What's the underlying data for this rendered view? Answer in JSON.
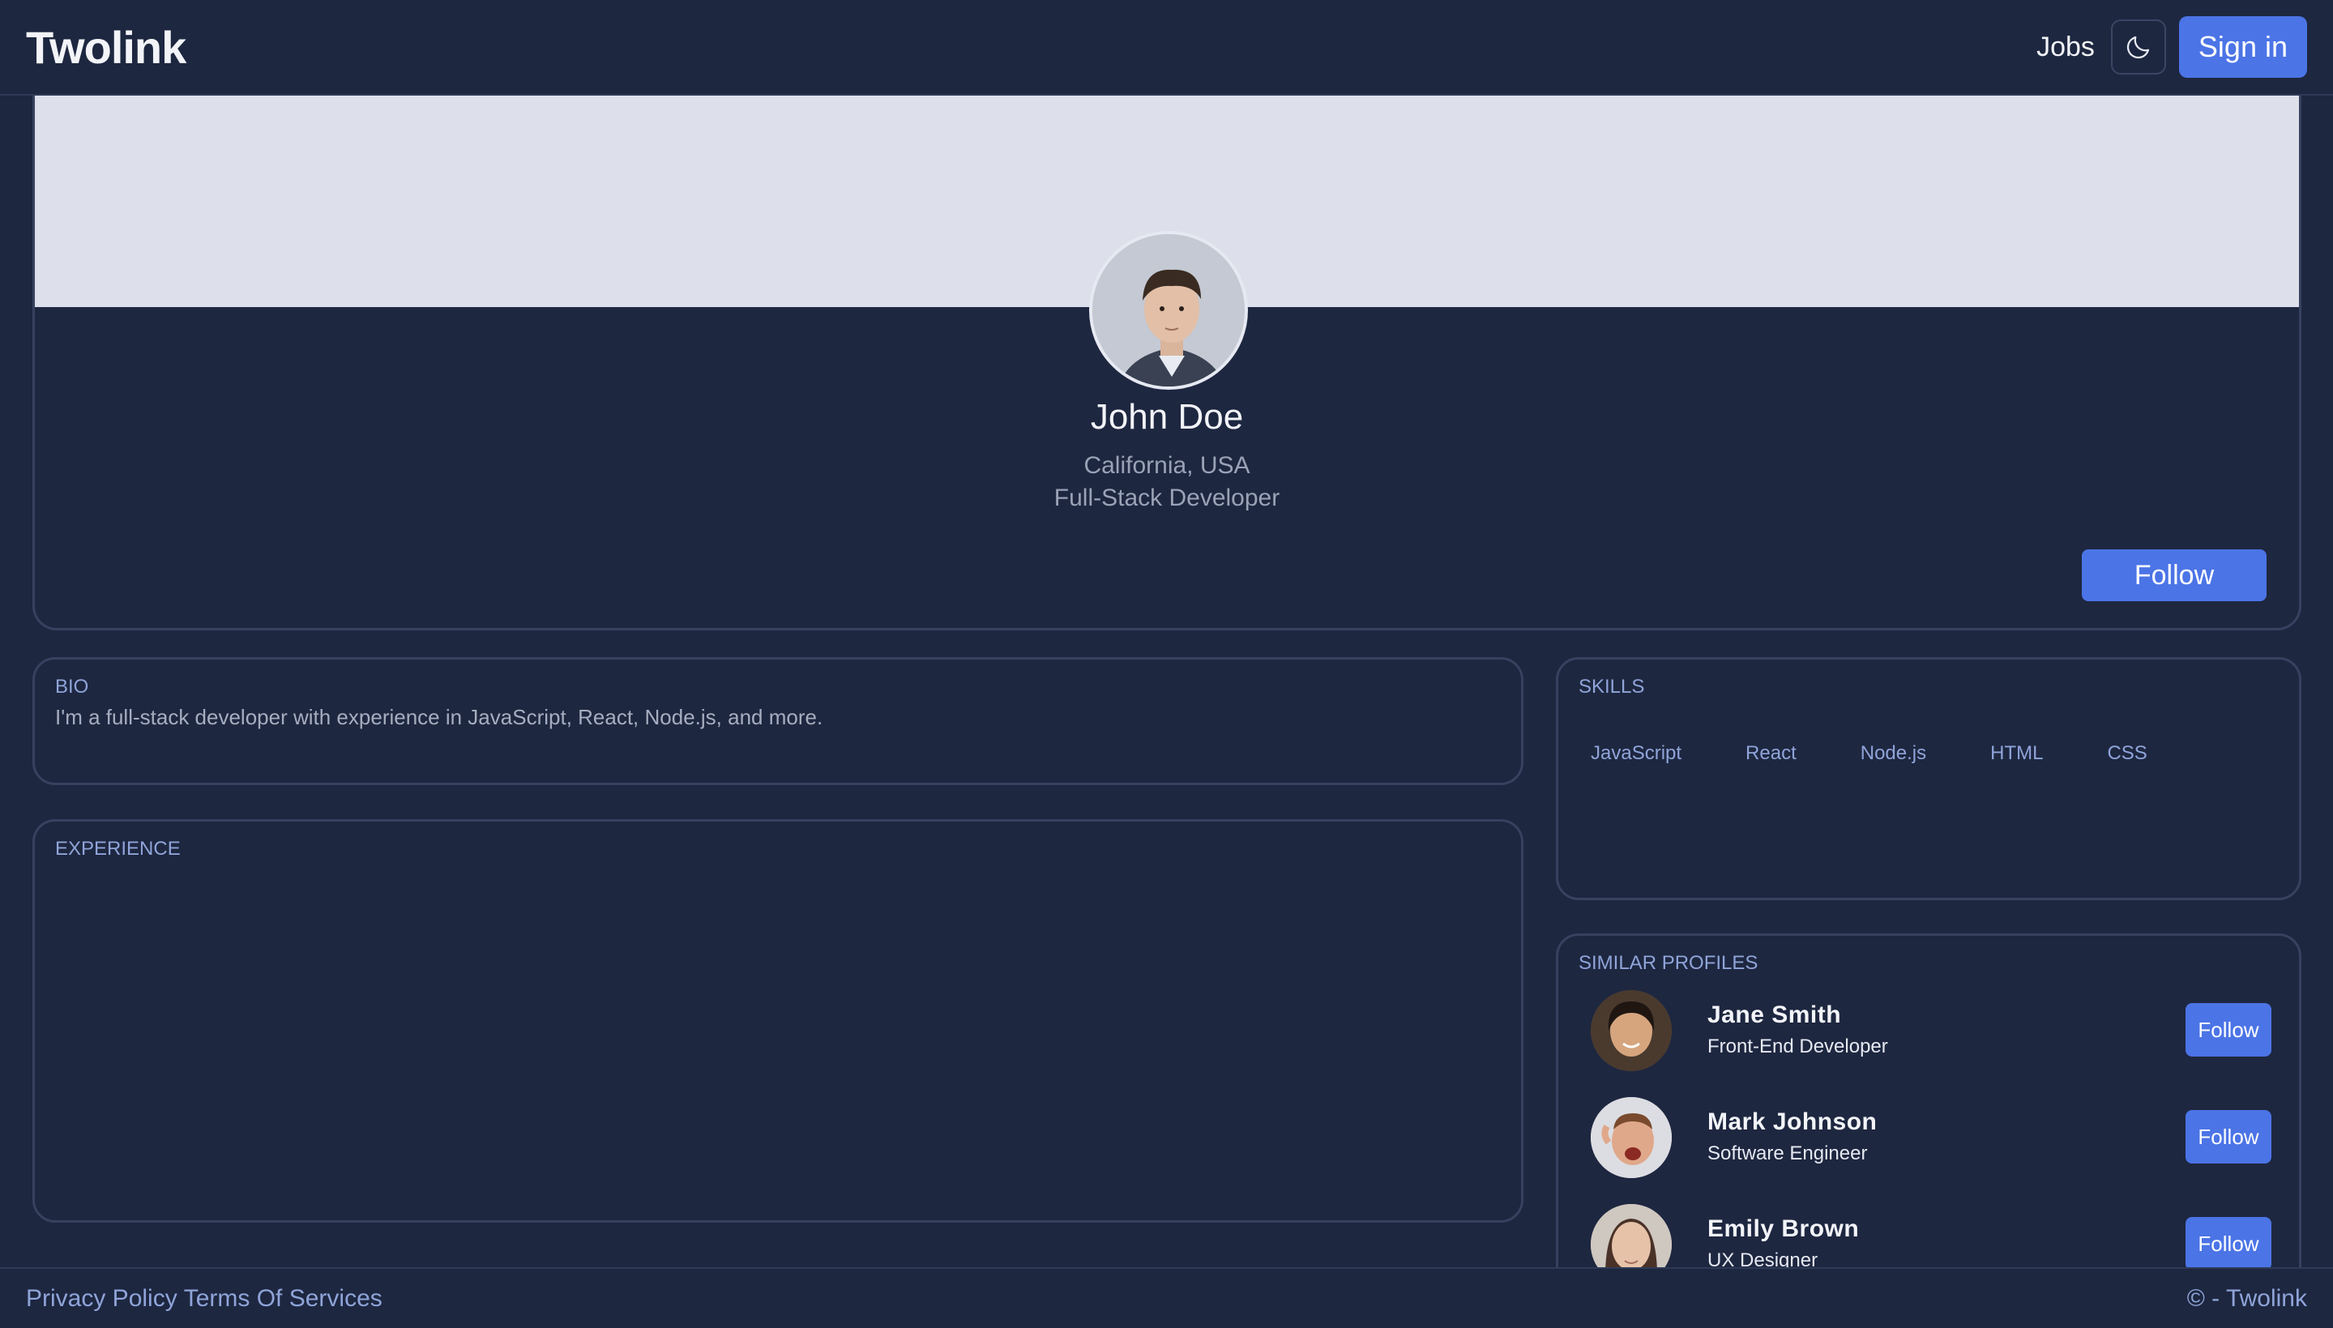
{
  "header": {
    "logo": "Twolink",
    "jobs_label": "Jobs",
    "theme_icon": "moon-icon",
    "signin_label": "Sign in"
  },
  "profile": {
    "name": "John Doe",
    "location": "California, USA",
    "title": "Full-Stack Developer",
    "follow_label": "Follow"
  },
  "bio": {
    "title": "BIO",
    "text": "I'm a full-stack developer with experience in JavaScript, React, Node.js, and more."
  },
  "experience": {
    "title": "EXPERIENCE"
  },
  "skills": {
    "title": "SKILLS",
    "items": [
      "JavaScript",
      "React",
      "Node.js",
      "HTML",
      "CSS"
    ]
  },
  "similar": {
    "title": "SIMILAR PROFILES",
    "profiles": [
      {
        "name": "Jane Smith",
        "role": "Front-End Developer",
        "follow_label": "Follow"
      },
      {
        "name": "Mark Johnson",
        "role": "Software Engineer",
        "follow_label": "Follow"
      },
      {
        "name": "Emily Brown",
        "role": "UX Designer",
        "follow_label": "Follow"
      }
    ]
  },
  "footer": {
    "privacy": "Privacy Policy",
    "terms": "Terms Of Services",
    "copyright": "© - Twolink"
  },
  "colors": {
    "background": "#1e2740",
    "accent": "#4b74e6",
    "banner": "#dde0ea",
    "muted": "#8fa4d9"
  }
}
